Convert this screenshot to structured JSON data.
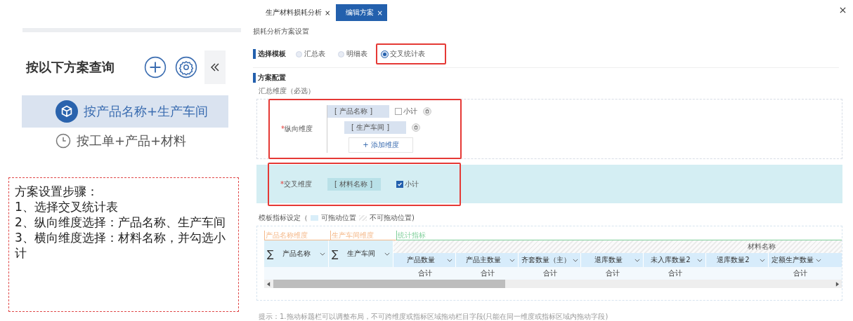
{
  "sidebar": {
    "title": "按以下方案查询",
    "items": [
      {
        "label": "按产品名称+生产车间",
        "selected": true
      },
      {
        "label": "按工单+产品+材料",
        "selected": false
      }
    ]
  },
  "note": {
    "lines": [
      "方案设置步骤：",
      "1、选择交叉统计表",
      "2、纵向维度选择：产品名称、生产车间",
      "3、横向维度选择：材料名称，并勾选小计"
    ]
  },
  "tabs": [
    {
      "label": "生产材料损耗分析",
      "close": "×",
      "selected": false
    },
    {
      "label": "编辑方案",
      "close": "×",
      "selected": true
    }
  ],
  "page_title": "损耗分析方案设置",
  "template": {
    "label": "选择模板",
    "options": [
      {
        "label": "汇总表",
        "selected": false
      },
      {
        "label": "明细表",
        "selected": false
      },
      {
        "label": "交叉统计表",
        "selected": true
      }
    ]
  },
  "config": {
    "label": "方案配置",
    "summary_label": "汇总维度（必选）",
    "required_mark": "*",
    "vertical": {
      "label": "纵向维度",
      "dims": [
        {
          "label": "[ 产品名称 ]",
          "subtotal_label": "小计",
          "subtotal": false
        },
        {
          "label": "[ 生产车间 ]"
        }
      ],
      "add": "+ 添加维度"
    },
    "cross": {
      "label": "交叉维度",
      "dim": "[ 材料名称 ]",
      "subtotal_label": "小计",
      "subtotal": true
    }
  },
  "legend": {
    "label": "模板指标设定（",
    "draggable": "可拖动位置",
    "fixed": "不可拖动位置)"
  },
  "table": {
    "groups": [
      {
        "label": "产品名称维度",
        "color": "#f5b98a"
      },
      {
        "label": "生产车间维度",
        "color": "#f5b98a"
      },
      {
        "label": "统计指标",
        "color": "#7fcf9a"
      }
    ],
    "sum_symbol": "∑",
    "dim_columns": [
      "产品名称",
      "生产车间"
    ],
    "span_header": "材料名称",
    "columns": [
      {
        "label": "产品数量",
        "total": "合计"
      },
      {
        "label": "产品主数量",
        "total": "合计"
      },
      {
        "label": "齐套数量（主）",
        "total": "合计"
      },
      {
        "label": "退库数量",
        "total": "合计"
      },
      {
        "label": "未入库数量2",
        "total": "合计"
      },
      {
        "label": "退库数量2"
      },
      {
        "label": "定额生产数量",
        "total": "合计"
      }
    ]
  },
  "hint": "提示：1.拖动标题栏可以调整布局，不可跨维度或指标区域拖动栏目字段(只能在同一维度或指标区域内拖动字段)"
}
